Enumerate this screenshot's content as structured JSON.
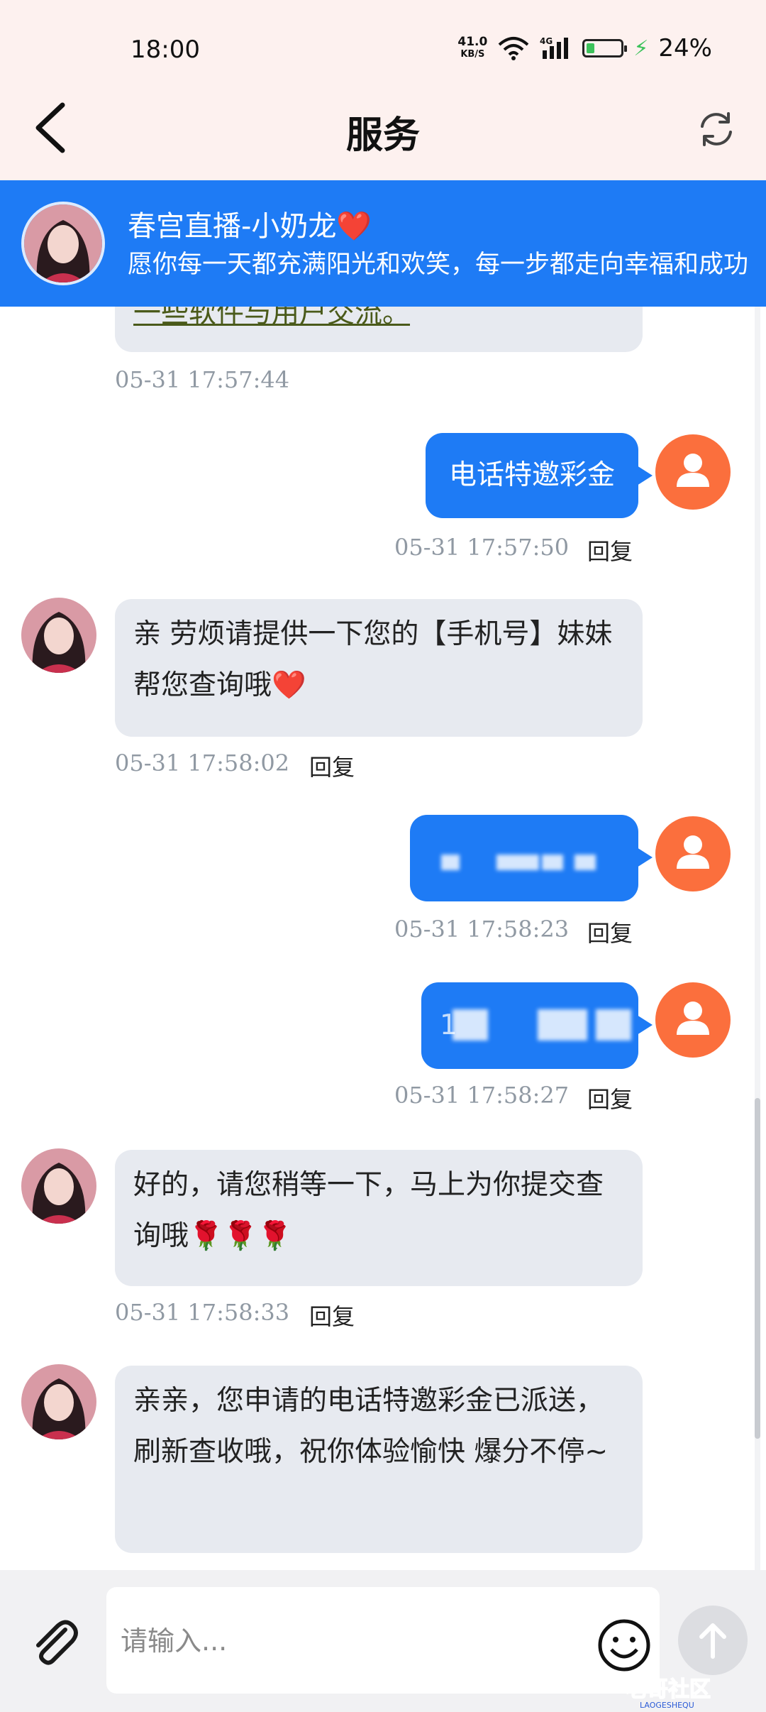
{
  "status_bar": {
    "time": "18:00",
    "net_speed": "41.0",
    "net_unit": "KB/S",
    "battery": "24%",
    "battery_level": 0.24
  },
  "nav": {
    "title": "服务"
  },
  "agent": {
    "name": "春宫直播-小奶龙❤️",
    "motto": "愿你每一天都充满阳光和欢笑，每一步都走向幸福和成功"
  },
  "messages": [
    {
      "side": "in",
      "text": "一些软件与用户交流。",
      "time": "05-31 17:57:44"
    },
    {
      "side": "out",
      "text": "电话特邀彩金",
      "time": "05-31 17:57:50",
      "reply": "回复"
    },
    {
      "side": "in",
      "text": "亲 劳烦请提供一下您的【手机号】妹妹帮您查询哦❤️",
      "time": "05-31 17:58:02",
      "reply": "回复"
    },
    {
      "side": "out",
      "text": "",
      "time": "05-31 17:58:23",
      "reply": "回复"
    },
    {
      "side": "out",
      "text": "1",
      "time": "05-31 17:58:27",
      "reply": "回复"
    },
    {
      "side": "in",
      "text": "好的，请您稍等一下，马上为你提交查询哦🌹🌹🌹",
      "time": "05-31 17:58:33",
      "reply": "回复"
    },
    {
      "side": "in",
      "text": "亲亲，您申请的电话特邀彩金已派送，刷新查收哦，祝你体验愉快 爆分不停~",
      "time": "",
      "reply": ""
    }
  ],
  "input": {
    "placeholder": "请输入..."
  },
  "watermark": {
    "text": "老哥社区",
    "sub": "LAOGESHEQU"
  },
  "colors": {
    "primary": "#1e7bf5",
    "bubble_in": "#e7eaf0",
    "user_avatar": "#fb6f3d",
    "topbar_bg": "#fdf1ef"
  }
}
